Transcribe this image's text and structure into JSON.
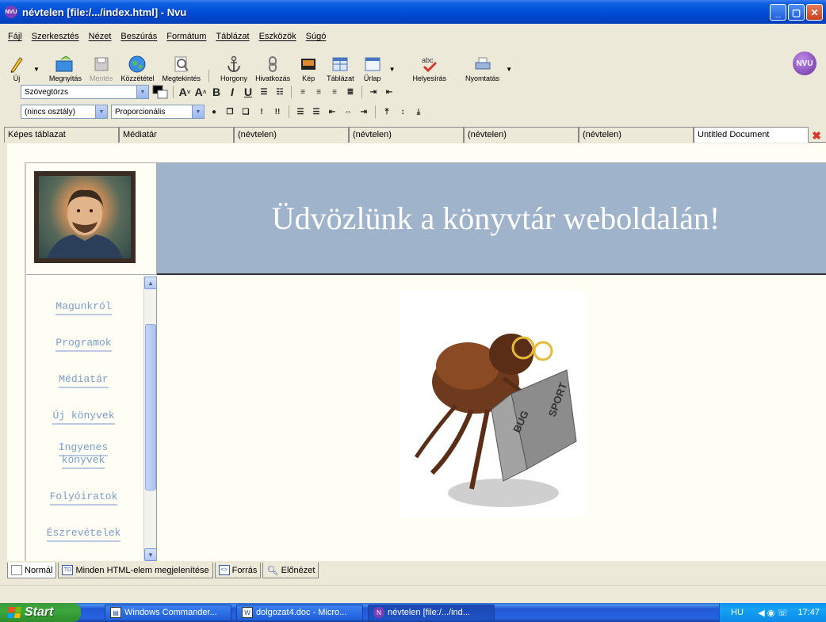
{
  "window": {
    "title": "névtelen [file:/.../index.html] - Nvu",
    "minimize": "_",
    "maximize": "▢",
    "close": "✕"
  },
  "menu": [
    "Fájl",
    "Szerkesztés",
    "Nézet",
    "Beszúrás",
    "Formátum",
    "Táblázat",
    "Eszközök",
    "Súgó"
  ],
  "toolbar": {
    "new": "Új",
    "open": "Megnyitás",
    "save": "Mentés",
    "publish": "Közzététel",
    "preview": "Megtekintés",
    "anchor": "Horgony",
    "link": "Hivatkozás",
    "image": "Kép",
    "table": "Táblázat",
    "form": "Űrlap",
    "spell": "Helyesírás",
    "print": "Nyomtatás",
    "logo": "NVU"
  },
  "format": {
    "paragraph_style": "Szövegtörzs",
    "class": "(nincs osztály)",
    "font": "Proporcionális"
  },
  "tabs": [
    {
      "label": "Képes táblazat"
    },
    {
      "label": "Médiatár"
    },
    {
      "label": "(névtelen)"
    },
    {
      "label": "(névtelen)"
    },
    {
      "label": "(névtelen)"
    },
    {
      "label": "(névtelen)"
    },
    {
      "label": "Untitled Document"
    }
  ],
  "page": {
    "banner": "Üdvözlünk a könyvtár weboldalán!",
    "nav": [
      "Magunkról",
      "Programok",
      "Médiatár",
      "Új könyvek",
      "Ingyenes könyvek",
      "Folyóiratok",
      "Észrevételek"
    ],
    "book_left": "BUG",
    "book_right": "SPORT"
  },
  "modes": [
    {
      "label": "Normál",
      "icon": "page-icon"
    },
    {
      "label": "Minden HTML-elem megjelenítése",
      "icon": "TD"
    },
    {
      "label": "Forrás",
      "icon": "<>"
    },
    {
      "label": "Előnézet",
      "icon": "magnifier-icon"
    }
  ],
  "taskbar": {
    "start": "Start",
    "tasks": [
      "Windows Commander...",
      "dolgozat4.doc - Micro...",
      "névtelen [file:/.../ind..."
    ],
    "lang": "HU",
    "time": "17:47"
  }
}
